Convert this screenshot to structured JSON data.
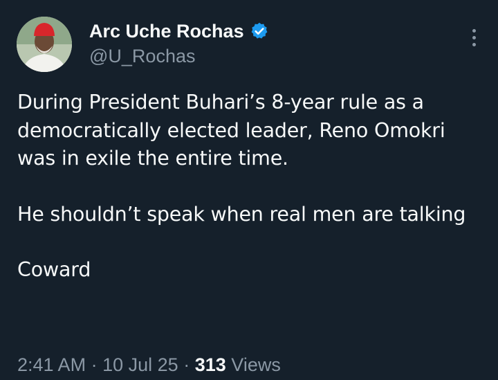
{
  "author": {
    "display_name": "Arc Uche Rochas",
    "handle": "@U_Rochas",
    "verified_color": "#1d9bf0"
  },
  "tweet": {
    "paragraphs": [
      "During President Buhari’s 8-year rule as a democratically elected leader, Reno Omokri was in exile the entire time.",
      "He shouldn’t speak when real men are talking",
      "Coward"
    ]
  },
  "meta": {
    "time": "2:41 AM",
    "date": "10 Jul 25",
    "separator": "·",
    "views_count": "313",
    "views_label": "Views"
  },
  "icons": [
    "verified-badge-icon",
    "more-options-icon"
  ],
  "colors": {
    "background": "#15202b",
    "text_primary": "#f7f9f9",
    "text_secondary": "#8b98a5"
  }
}
